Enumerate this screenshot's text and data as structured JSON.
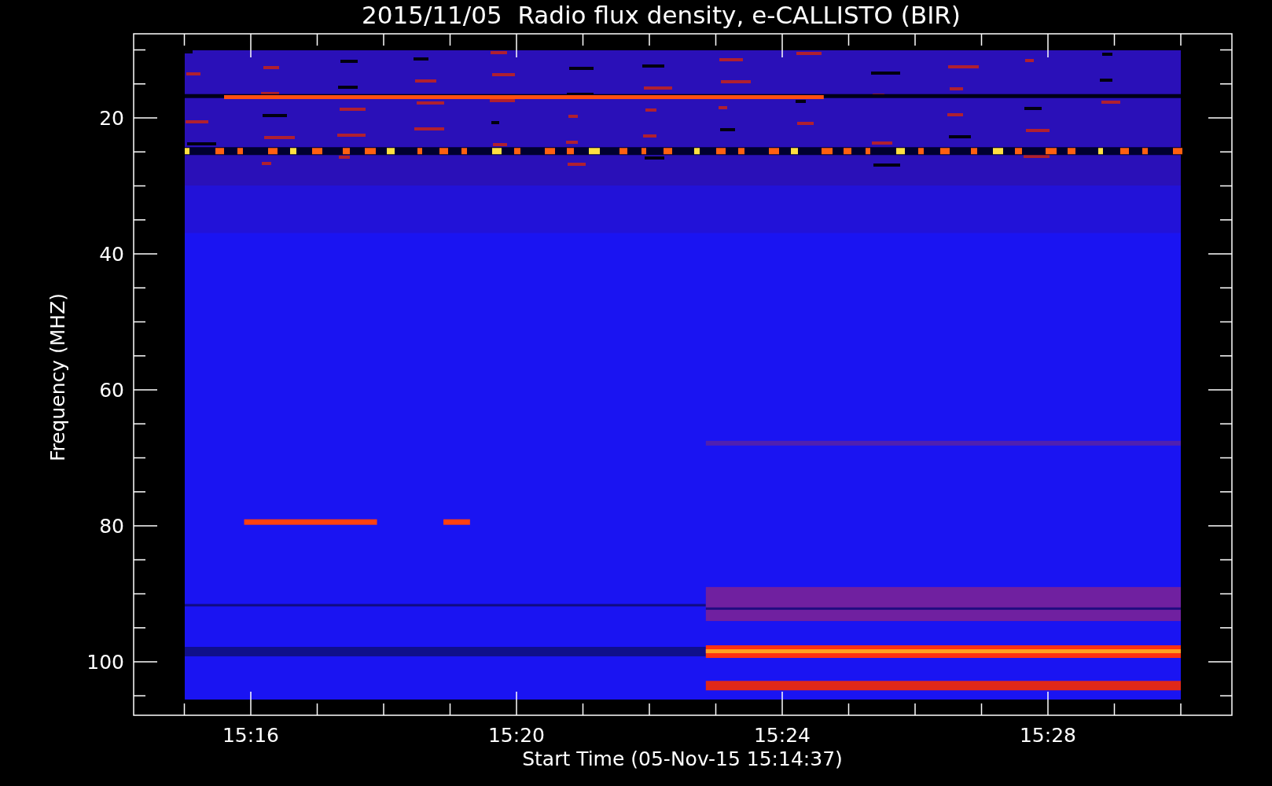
{
  "title": "2015/11/05  Radio flux density, e-CALLISTO (BIR)",
  "chart": {
    "ylabel": "Frequency (MHZ)",
    "xlabel": "Start Time (05-Nov-15 15:14:37)",
    "yticks": [
      "20",
      "40",
      "60",
      "80",
      "100"
    ],
    "xticks": [
      "15:16",
      "15:20",
      "15:24",
      "15:28"
    ]
  }
}
